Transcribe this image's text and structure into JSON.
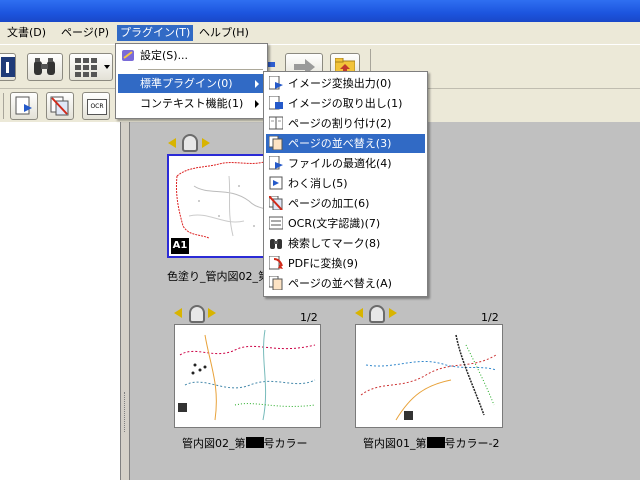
{
  "menubar": {
    "items": [
      {
        "label": "文書(D)"
      },
      {
        "label": "ページ(P)"
      },
      {
        "label": "プラグイン(T)"
      },
      {
        "label": "ヘルプ(H)"
      }
    ]
  },
  "plugin_menu": {
    "items": [
      {
        "label": "設定(S)..."
      },
      {
        "label": "標準プラグイン(0)"
      },
      {
        "label": "コンテキスト機能(1)"
      }
    ]
  },
  "standard_submenu": {
    "items": [
      {
        "label": "イメージ変換出力(0)"
      },
      {
        "label": "イメージの取り出し(1)"
      },
      {
        "label": "ページの割り付け(2)"
      },
      {
        "label": "ページの並べ替え(3)"
      },
      {
        "label": "ファイルの最適化(4)"
      },
      {
        "label": "わく消し(5)"
      },
      {
        "label": "ページの加工(6)"
      },
      {
        "label": "OCR(文字認識)(7)"
      },
      {
        "label": "検索してマーク(8)"
      },
      {
        "label": "PDFに変換(9)"
      },
      {
        "label": "ページの並べ替え(A)"
      }
    ]
  },
  "toolbar": {
    "ocr_label": "OCR"
  },
  "documents": [
    {
      "caption_start": "色塗り_管内図02_第",
      "badge": "A1"
    },
    {
      "page_count": "1/2",
      "caption_start": "管内図02_第",
      "caption_end": "号カラー"
    },
    {
      "page_count": "1/2",
      "caption_start": "管内図01_第",
      "caption_end": "号カラー-2"
    }
  ],
  "colors": {
    "menu_highlight": "#316ac5",
    "title_bar": "#1c54de",
    "selection_border": "#2b2bd6"
  }
}
